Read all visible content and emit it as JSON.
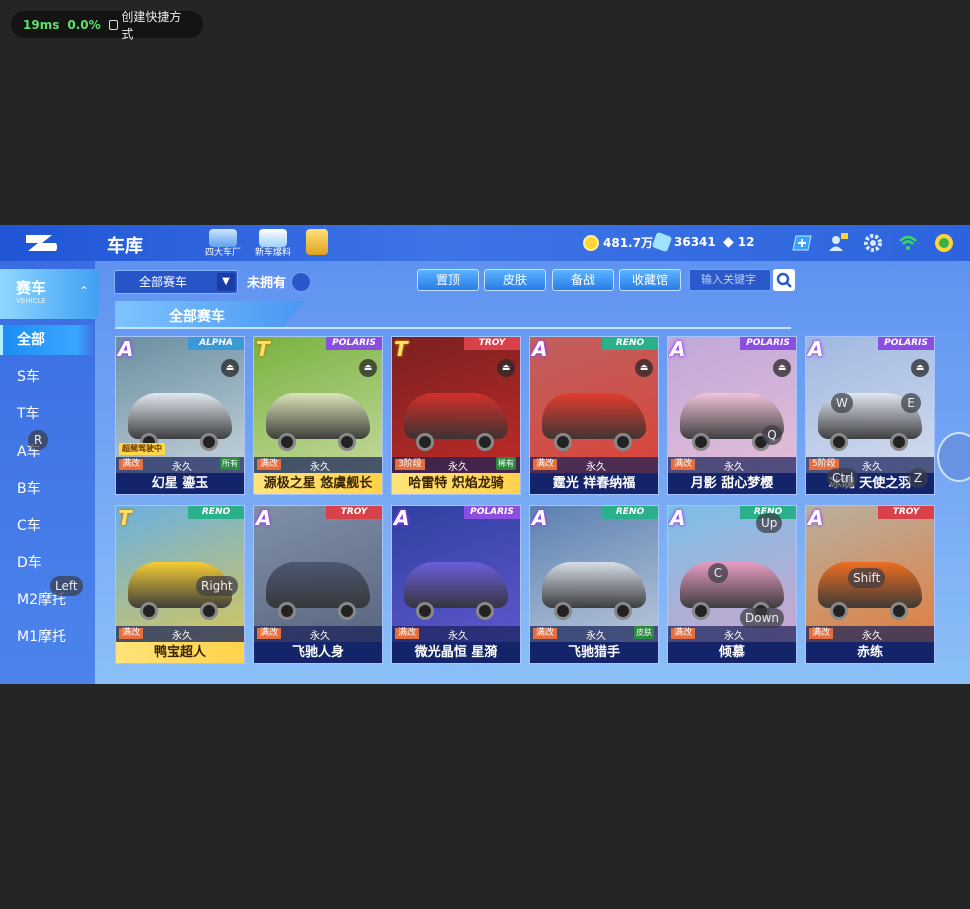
{
  "overlay": {
    "latency": "19ms",
    "percent": "0.0%",
    "shortcut_label": "创建快捷方式"
  },
  "header": {
    "title": "车库",
    "icons": [
      {
        "name": "four-factories-icon",
        "label": "四大车厂"
      },
      {
        "name": "new-car-news-icon",
        "label": "新车爆料"
      },
      {
        "name": "gift-icon",
        "label": ""
      }
    ],
    "currencies": [
      {
        "name": "coin-icon",
        "value": "481.7万",
        "color": "#ffd43a"
      },
      {
        "name": "voucher-icon",
        "value": "36341",
        "color": "#9fe3ff"
      },
      {
        "name": "diamond-icon",
        "value": "12",
        "color": "#ffffff"
      }
    ]
  },
  "sidebar": {
    "category": "赛车",
    "category_sub": "VEHICLE",
    "items": [
      {
        "label": "全部",
        "active": true
      },
      {
        "label": "S车",
        "active": false
      },
      {
        "label": "T车",
        "active": false
      },
      {
        "label": "A车",
        "active": false
      },
      {
        "label": "B车",
        "active": false
      },
      {
        "label": "C车",
        "active": false
      },
      {
        "label": "D车",
        "active": false
      },
      {
        "label": "M2摩托",
        "active": false
      },
      {
        "label": "M1摩托",
        "active": false
      }
    ]
  },
  "toolbar": {
    "filter_value": "全部赛车",
    "not_owned_label": "未拥有",
    "tabs": [
      "置顶",
      "皮肤",
      "备战",
      "收藏馆"
    ],
    "search_placeholder": "输入关键字"
  },
  "section": {
    "title": "全部赛车"
  },
  "cars": [
    {
      "name": "幻星 鎏玉",
      "grade": "A",
      "brand": "ALPHA",
      "duration": "永久",
      "mod": "满改",
      "badge": "所有",
      "tag": "超频驾驶中",
      "color": "#e8eef5",
      "bg": "#6a8ea0",
      "gold": false
    },
    {
      "name": "源极之星 悠虞舰长",
      "grade": "T",
      "brand": "POLARIS",
      "duration": "永久",
      "mod": "满改",
      "badge": "",
      "tag": "",
      "color": "#e0e8c0",
      "bg": "#7ab240",
      "gold": true
    },
    {
      "name": "哈雷特 炽焰龙骑",
      "grade": "T",
      "brand": "TROY",
      "duration": "永久",
      "mod": "3阶段",
      "badge": "稀有",
      "tag": "",
      "color": "#d9302a",
      "bg": "#7a2020",
      "gold": true
    },
    {
      "name": "霆光 祥春纳福",
      "grade": "A",
      "brand": "RENO",
      "duration": "永久",
      "mod": "满改",
      "badge": "",
      "tag": "",
      "color": "#e43a2a",
      "bg": "#c06060",
      "gold": false
    },
    {
      "name": "月影 甜心梦樱",
      "grade": "A",
      "brand": "POLARIS",
      "duration": "永久",
      "mod": "满改",
      "badge": "",
      "tag": "",
      "color": "#f2c6d8",
      "bg": "#c0a8d8",
      "gold": false
    },
    {
      "name": "冰魄 天使之羽",
      "grade": "A",
      "brand": "POLARIS",
      "duration": "永久",
      "mod": "5阶段",
      "badge": "",
      "tag": "",
      "color": "#e6eaf4",
      "bg": "#a0b8e0",
      "gold": false
    },
    {
      "name": "鸭宝超人",
      "grade": "T",
      "brand": "RENO",
      "duration": "永久",
      "mod": "满改",
      "badge": "",
      "tag": "",
      "color": "#ffcf2a",
      "bg": "#6ab0e0",
      "gold": true
    },
    {
      "name": "飞驰人身",
      "grade": "A",
      "brand": "TROY",
      "duration": "永久",
      "mod": "满改",
      "badge": "",
      "tag": "",
      "color": "#4a5470",
      "bg": "#8090a8",
      "gold": false
    },
    {
      "name": "微光晶恒 星漪",
      "grade": "A",
      "brand": "POLARIS",
      "duration": "永久",
      "mod": "满改",
      "badge": "",
      "tag": "",
      "color": "#7060e0",
      "bg": "#3040a0",
      "gold": false
    },
    {
      "name": "飞驰猎手",
      "grade": "A",
      "brand": "RENO",
      "duration": "永久",
      "mod": "满改",
      "badge": "皮肤",
      "tag": "",
      "color": "#dfe3ea",
      "bg": "#5a80b0",
      "gold": false
    },
    {
      "name": "倾慕",
      "grade": "A",
      "brand": "RENO",
      "duration": "永久",
      "mod": "满改",
      "badge": "",
      "tag": "",
      "color": "#ef9ac0",
      "bg": "#7ac0e8",
      "gold": false
    },
    {
      "name": "赤练",
      "grade": "A",
      "brand": "TROY",
      "duration": "永久",
      "mod": "满改",
      "badge": "",
      "tag": "",
      "color": "#f06a1a",
      "bg": "#b8b0a0",
      "gold": false
    }
  ],
  "key_hints": [
    "R",
    "Left",
    "Right",
    "W",
    "E",
    "Q",
    "Ctrl",
    "Z",
    "Up",
    "C",
    "Shift",
    "Down"
  ]
}
